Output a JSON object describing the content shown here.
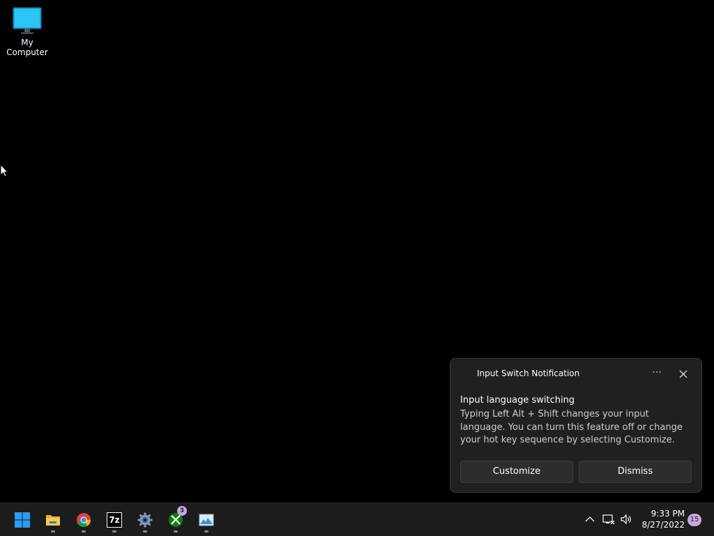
{
  "desktop": {
    "icons": [
      {
        "label": "My Computer",
        "icon": "monitor-icon"
      }
    ]
  },
  "notification": {
    "app_name": "Input Switch Notification",
    "more_label": "···",
    "title": "Input language switching",
    "body": "Typing Left Alt + Shift changes your input language. You can turn this feature off or change your hot key sequence by selecting Customize.",
    "buttons": {
      "customize": "Customize",
      "dismiss": "Dismiss"
    }
  },
  "taskbar": {
    "apps": [
      {
        "name": "start",
        "icon": "windows-start-icon"
      },
      {
        "name": "file-explorer",
        "icon": "folder-icon"
      },
      {
        "name": "chrome",
        "icon": "chrome-icon"
      },
      {
        "name": "7zip",
        "icon": "7zip-icon",
        "text": "7z"
      },
      {
        "name": "settings",
        "icon": "gear-icon"
      },
      {
        "name": "xbox",
        "icon": "xbox-icon",
        "badge": "3"
      },
      {
        "name": "photos",
        "icon": "image-icon"
      }
    ],
    "tray": {
      "time": "9:33 PM",
      "date": "8/27/2022",
      "notification_count": "15"
    }
  },
  "colors": {
    "taskbar_bg": "#1c1c1c",
    "toast_bg": "#202020",
    "badge": "#c9a7e0",
    "accent": "#0078d4"
  }
}
